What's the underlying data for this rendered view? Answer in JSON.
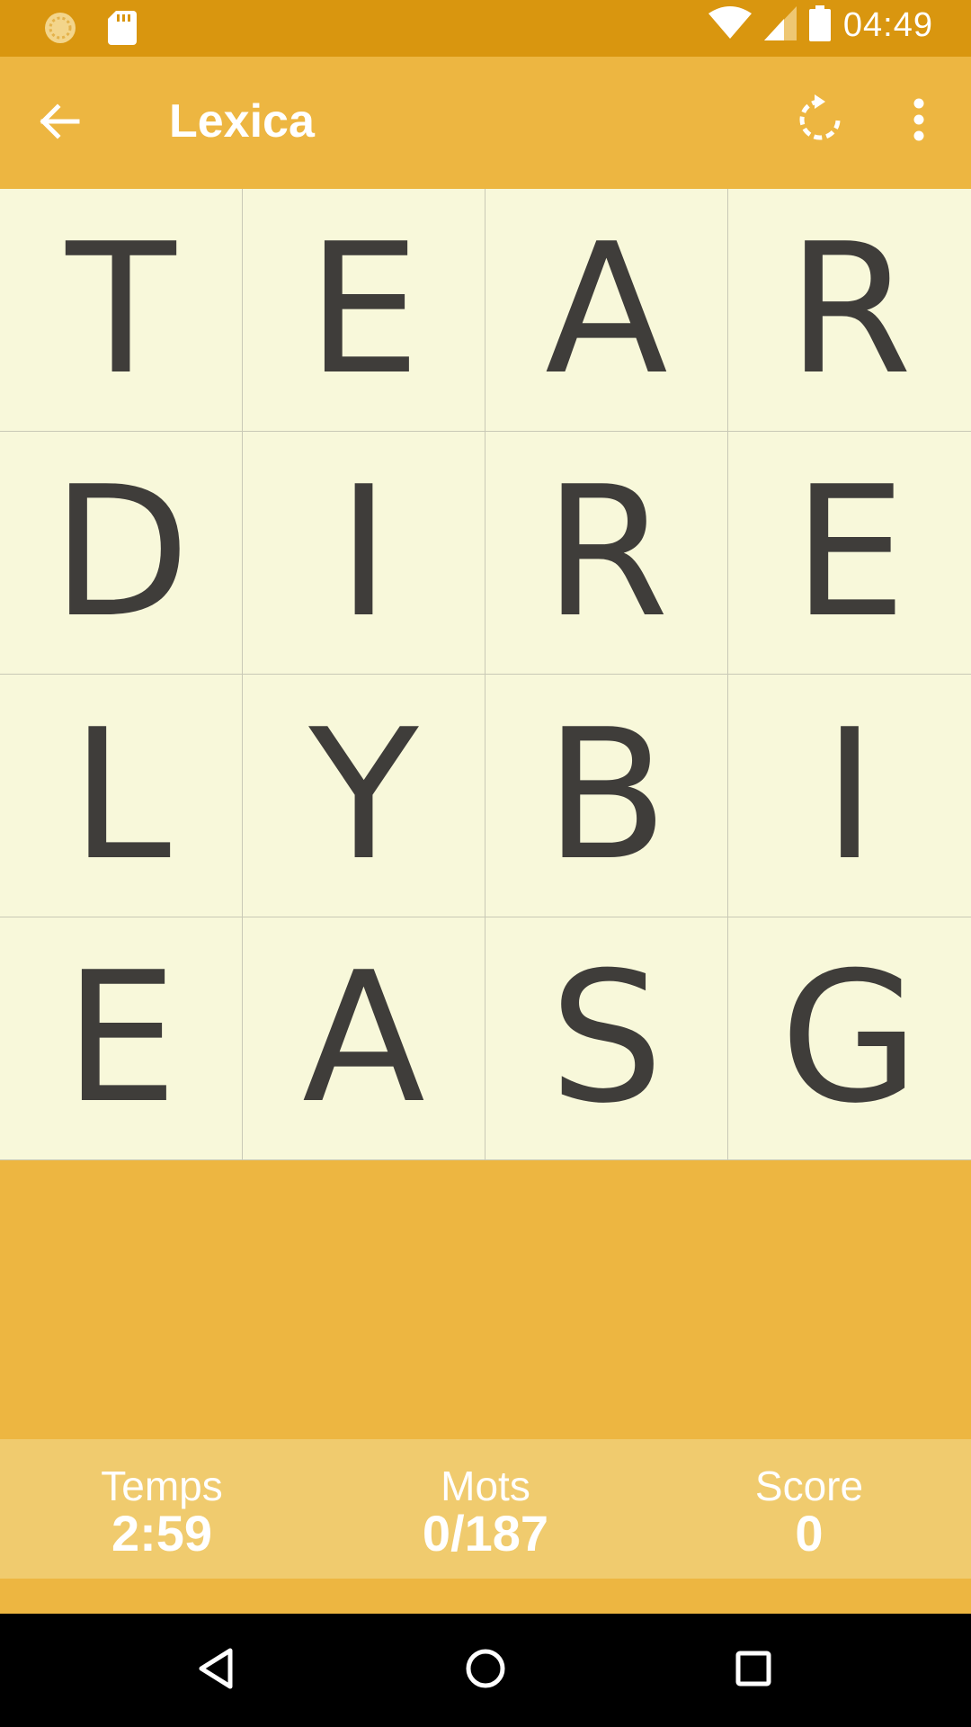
{
  "status_bar": {
    "time": "04:49",
    "icons": [
      "notification-circle-icon",
      "sd-card-icon",
      "wifi-icon",
      "signal-icon",
      "battery-icon"
    ]
  },
  "app_bar": {
    "title": "Lexica",
    "icons": [
      "back-arrow-icon",
      "refresh-icon",
      "overflow-menu-icon"
    ]
  },
  "board": {
    "rows": [
      [
        "T",
        "E",
        "A",
        "R"
      ],
      [
        "D",
        "I",
        "R",
        "E"
      ],
      [
        "L",
        "Y",
        "B",
        "I"
      ],
      [
        "E",
        "A",
        "S",
        "G"
      ]
    ]
  },
  "stats": {
    "time": {
      "label": "Temps",
      "value": "2:59"
    },
    "words": {
      "label": "Mots",
      "value": "0/187"
    },
    "score": {
      "label": "Score",
      "value": "0"
    }
  },
  "nav_bar": {
    "icons": [
      "nav-back-icon",
      "nav-home-icon",
      "nav-recents-icon"
    ]
  },
  "colors": {
    "status_bar": "#D9960F",
    "app_bar": "#EDB641",
    "board_bg": "#F8F8DA",
    "letter": "#3F3D3A",
    "stats_bg": "#F0CB6E"
  }
}
